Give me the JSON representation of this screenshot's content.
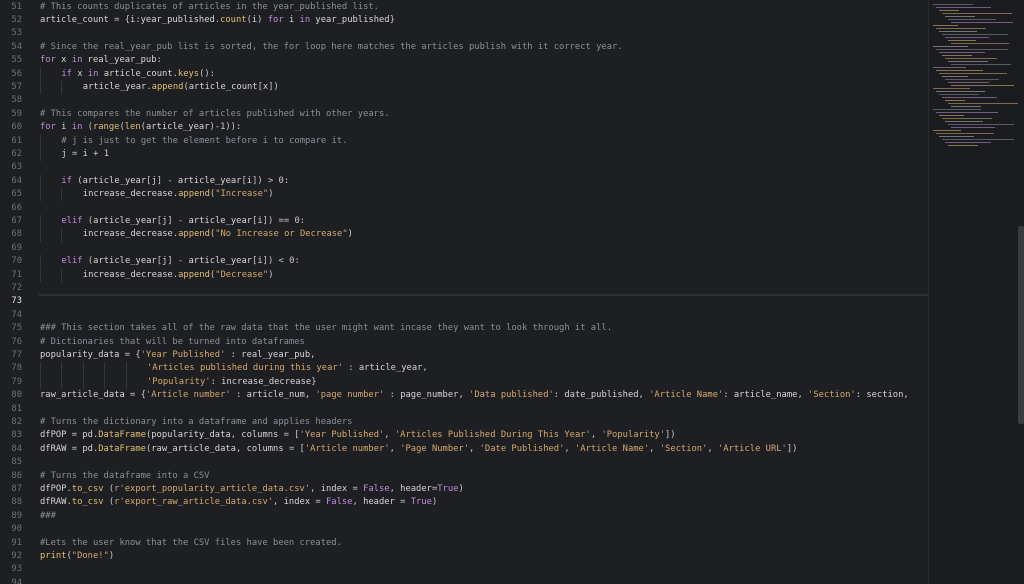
{
  "editor": {
    "current_line": 73,
    "lines": [
      {
        "n": 51,
        "indent": 0,
        "tokens": [
          [
            "cm",
            "# This counts duplicates of articles in the year_published list."
          ]
        ]
      },
      {
        "n": 52,
        "indent": 0,
        "tokens": [
          [
            "id",
            "article_count "
          ],
          [
            "op",
            "= {"
          ],
          [
            "id",
            "i"
          ],
          [
            "op",
            ":"
          ],
          [
            "id",
            "year_published"
          ],
          [
            "op",
            "."
          ],
          [
            "fn",
            "count"
          ],
          [
            "op",
            "("
          ],
          [
            "id",
            "i"
          ],
          [
            "op",
            ") "
          ],
          [
            "kw",
            "for"
          ],
          [
            "id",
            " i "
          ],
          [
            "kw",
            "in"
          ],
          [
            "id",
            " year_published"
          ],
          [
            "op",
            "}"
          ]
        ]
      },
      {
        "n": 53,
        "indent": 0,
        "tokens": []
      },
      {
        "n": 54,
        "indent": 0,
        "tokens": [
          [
            "cm",
            "# Since the real_year_pub list is sorted, the for loop here matches the articles publish with it correct year."
          ]
        ]
      },
      {
        "n": 55,
        "indent": 0,
        "tokens": [
          [
            "kw",
            "for"
          ],
          [
            "id",
            " x "
          ],
          [
            "kw",
            "in"
          ],
          [
            "id",
            " real_year_pub"
          ],
          [
            "op",
            ":"
          ]
        ]
      },
      {
        "n": 56,
        "indent": 1,
        "tokens": [
          [
            "kw",
            "if"
          ],
          [
            "id",
            " x "
          ],
          [
            "kw",
            "in"
          ],
          [
            "id",
            " article_count"
          ],
          [
            "op",
            "."
          ],
          [
            "fn",
            "keys"
          ],
          [
            "op",
            "():"
          ]
        ]
      },
      {
        "n": 57,
        "indent": 2,
        "tokens": [
          [
            "id",
            "article_year"
          ],
          [
            "op",
            "."
          ],
          [
            "fn",
            "append"
          ],
          [
            "op",
            "("
          ],
          [
            "id",
            "article_count"
          ],
          [
            "op",
            "["
          ],
          [
            "id",
            "x"
          ],
          [
            "op",
            "])"
          ]
        ]
      },
      {
        "n": 58,
        "indent": 0,
        "tokens": []
      },
      {
        "n": 59,
        "indent": 0,
        "tokens": [
          [
            "cm",
            "# This compares the number of articles published with other years."
          ]
        ]
      },
      {
        "n": 60,
        "indent": 0,
        "tokens": [
          [
            "kw",
            "for"
          ],
          [
            "id",
            " i "
          ],
          [
            "kw",
            "in"
          ],
          [
            "op",
            " ("
          ],
          [
            "fn",
            "range"
          ],
          [
            "op",
            "("
          ],
          [
            "fn",
            "len"
          ],
          [
            "op",
            "("
          ],
          [
            "id",
            "article_year"
          ],
          [
            "op",
            ")-1)):"
          ]
        ]
      },
      {
        "n": 61,
        "indent": 1,
        "tokens": [
          [
            "cm",
            "# j is just to get the element before i to compare it."
          ]
        ]
      },
      {
        "n": 62,
        "indent": 1,
        "tokens": [
          [
            "id",
            "j "
          ],
          [
            "op",
            "= "
          ],
          [
            "id",
            "i "
          ],
          [
            "op",
            "+ 1"
          ]
        ]
      },
      {
        "n": 63,
        "indent": 0,
        "tokens": []
      },
      {
        "n": 64,
        "indent": 1,
        "tokens": [
          [
            "kw",
            "if"
          ],
          [
            "op",
            " ("
          ],
          [
            "id",
            "article_year"
          ],
          [
            "op",
            "["
          ],
          [
            "id",
            "j"
          ],
          [
            "op",
            "] - "
          ],
          [
            "id",
            "article_year"
          ],
          [
            "op",
            "["
          ],
          [
            "id",
            "i"
          ],
          [
            "op",
            "]) > 0:"
          ]
        ]
      },
      {
        "n": 65,
        "indent": 2,
        "tokens": [
          [
            "id",
            "increase_decrease"
          ],
          [
            "op",
            "."
          ],
          [
            "fn",
            "append"
          ],
          [
            "op",
            "("
          ],
          [
            "str",
            "\"Increase\""
          ],
          [
            "op",
            ")"
          ]
        ]
      },
      {
        "n": 66,
        "indent": 0,
        "tokens": []
      },
      {
        "n": 67,
        "indent": 1,
        "tokens": [
          [
            "kw",
            "elif"
          ],
          [
            "op",
            " ("
          ],
          [
            "id",
            "article_year"
          ],
          [
            "op",
            "["
          ],
          [
            "id",
            "j"
          ],
          [
            "op",
            "] - "
          ],
          [
            "id",
            "article_year"
          ],
          [
            "op",
            "["
          ],
          [
            "id",
            "i"
          ],
          [
            "op",
            "]) == 0:"
          ]
        ]
      },
      {
        "n": 68,
        "indent": 2,
        "tokens": [
          [
            "id",
            "increase_decrease"
          ],
          [
            "op",
            "."
          ],
          [
            "fn",
            "append"
          ],
          [
            "op",
            "("
          ],
          [
            "str",
            "\"No Increase or Decrease\""
          ],
          [
            "op",
            ")"
          ]
        ]
      },
      {
        "n": 69,
        "indent": 0,
        "tokens": []
      },
      {
        "n": 70,
        "indent": 1,
        "tokens": [
          [
            "kw",
            "elif"
          ],
          [
            "op",
            " ("
          ],
          [
            "id",
            "article_year"
          ],
          [
            "op",
            "["
          ],
          [
            "id",
            "j"
          ],
          [
            "op",
            "] - "
          ],
          [
            "id",
            "article_year"
          ],
          [
            "op",
            "["
          ],
          [
            "id",
            "i"
          ],
          [
            "op",
            "]) < 0:"
          ]
        ]
      },
      {
        "n": 71,
        "indent": 2,
        "tokens": [
          [
            "id",
            "increase_decrease"
          ],
          [
            "op",
            "."
          ],
          [
            "fn",
            "append"
          ],
          [
            "op",
            "("
          ],
          [
            "str",
            "\"Decrease\""
          ],
          [
            "op",
            ")"
          ]
        ]
      },
      {
        "n": 72,
        "indent": 0,
        "tokens": []
      },
      {
        "n": 73,
        "indent": 0,
        "tokens": []
      },
      {
        "n": 74,
        "indent": 0,
        "tokens": []
      },
      {
        "n": 75,
        "indent": 0,
        "tokens": [
          [
            "cm",
            "### This section takes all of the raw data that the user might want incase they want to look through it all."
          ]
        ]
      },
      {
        "n": 76,
        "indent": 0,
        "tokens": [
          [
            "cm",
            "# Dictionaries that will be turned into dataframes"
          ]
        ]
      },
      {
        "n": 77,
        "indent": 0,
        "tokens": [
          [
            "id",
            "popularity_data "
          ],
          [
            "op",
            "= {"
          ],
          [
            "str",
            "'Year Published'"
          ],
          [
            "op",
            " : "
          ],
          [
            "id",
            "real_year_pub"
          ],
          [
            "op",
            ","
          ]
        ]
      },
      {
        "n": 78,
        "indent": 5,
        "tokens": [
          [
            "str",
            "'Articles published during this year'"
          ],
          [
            "op",
            " : "
          ],
          [
            "id",
            "article_year"
          ],
          [
            "op",
            ","
          ]
        ]
      },
      {
        "n": 79,
        "indent": 5,
        "tokens": [
          [
            "str",
            "'Popularity'"
          ],
          [
            "op",
            ": "
          ],
          [
            "id",
            "increase_decrease"
          ],
          [
            "op",
            "}"
          ]
        ]
      },
      {
        "n": 80,
        "indent": 0,
        "tokens": [
          [
            "id",
            "raw_article_data "
          ],
          [
            "op",
            "= {"
          ],
          [
            "str",
            "'Article number'"
          ],
          [
            "op",
            " : "
          ],
          [
            "id",
            "article_num"
          ],
          [
            "op",
            ", "
          ],
          [
            "str",
            "'page number'"
          ],
          [
            "op",
            " : "
          ],
          [
            "id",
            "page_number"
          ],
          [
            "op",
            ", "
          ],
          [
            "str",
            "'Data published'"
          ],
          [
            "op",
            ": "
          ],
          [
            "id",
            "date_published"
          ],
          [
            "op",
            ", "
          ],
          [
            "str",
            "'Article Name'"
          ],
          [
            "op",
            ": "
          ],
          [
            "id",
            "article_name"
          ],
          [
            "op",
            ", "
          ],
          [
            "str",
            "'Section'"
          ],
          [
            "op",
            ": "
          ],
          [
            "id",
            "section"
          ],
          [
            "op",
            ","
          ]
        ]
      },
      {
        "n": 81,
        "indent": 0,
        "tokens": []
      },
      {
        "n": 82,
        "indent": 0,
        "tokens": [
          [
            "cm",
            "# Turns the dictionary into a dataframe and applies headers"
          ]
        ]
      },
      {
        "n": 83,
        "indent": 0,
        "tokens": [
          [
            "id",
            "dfPOP "
          ],
          [
            "op",
            "= "
          ],
          [
            "id",
            "pd"
          ],
          [
            "op",
            "."
          ],
          [
            "fn",
            "DataFrame"
          ],
          [
            "op",
            "("
          ],
          [
            "id",
            "popularity_data"
          ],
          [
            "op",
            ", "
          ],
          [
            "id",
            "columns "
          ],
          [
            "op",
            "= ["
          ],
          [
            "str",
            "'Year Published'"
          ],
          [
            "op",
            ", "
          ],
          [
            "str",
            "'Articles Published During This Year'"
          ],
          [
            "op",
            ", "
          ],
          [
            "str",
            "'Popularity'"
          ],
          [
            "op",
            "])"
          ]
        ]
      },
      {
        "n": 84,
        "indent": 0,
        "tokens": [
          [
            "id",
            "dfRAW "
          ],
          [
            "op",
            "= "
          ],
          [
            "id",
            "pd"
          ],
          [
            "op",
            "."
          ],
          [
            "fn",
            "DataFrame"
          ],
          [
            "op",
            "("
          ],
          [
            "id",
            "raw_article_data"
          ],
          [
            "op",
            ", "
          ],
          [
            "id",
            "columns "
          ],
          [
            "op",
            "= ["
          ],
          [
            "str",
            "'Article number'"
          ],
          [
            "op",
            ", "
          ],
          [
            "str",
            "'Page Number'"
          ],
          [
            "op",
            ", "
          ],
          [
            "str",
            "'Date Published'"
          ],
          [
            "op",
            ", "
          ],
          [
            "str",
            "'Article Name'"
          ],
          [
            "op",
            ", "
          ],
          [
            "str",
            "'Section'"
          ],
          [
            "op",
            ", "
          ],
          [
            "str",
            "'Article URL'"
          ],
          [
            "op",
            "])"
          ]
        ]
      },
      {
        "n": 85,
        "indent": 0,
        "tokens": []
      },
      {
        "n": 86,
        "indent": 0,
        "tokens": [
          [
            "cm",
            "# Turns the dataframe into a CSV"
          ]
        ]
      },
      {
        "n": 87,
        "indent": 0,
        "tokens": [
          [
            "id",
            "dfPOP"
          ],
          [
            "op",
            "."
          ],
          [
            "fn",
            "to_csv"
          ],
          [
            "op",
            " ("
          ],
          [
            "str",
            "r'export_popularity_article_data.csv'"
          ],
          [
            "op",
            ", "
          ],
          [
            "id",
            "index "
          ],
          [
            "op",
            "= "
          ],
          [
            "kw",
            "False"
          ],
          [
            "op",
            ", "
          ],
          [
            "id",
            "header"
          ],
          [
            "op",
            "="
          ],
          [
            "kw",
            "True"
          ],
          [
            "op",
            ")"
          ]
        ]
      },
      {
        "n": 88,
        "indent": 0,
        "tokens": [
          [
            "id",
            "dfRAW"
          ],
          [
            "op",
            "."
          ],
          [
            "fn",
            "to_csv"
          ],
          [
            "op",
            " ("
          ],
          [
            "str",
            "r'export_raw_article_data.csv'"
          ],
          [
            "op",
            ", "
          ],
          [
            "id",
            "index "
          ],
          [
            "op",
            "= "
          ],
          [
            "kw",
            "False"
          ],
          [
            "op",
            ", "
          ],
          [
            "id",
            "header "
          ],
          [
            "op",
            "= "
          ],
          [
            "kw",
            "True"
          ],
          [
            "op",
            ")"
          ]
        ]
      },
      {
        "n": 89,
        "indent": 0,
        "tokens": [
          [
            "cm",
            "###"
          ]
        ]
      },
      {
        "n": 90,
        "indent": 0,
        "tokens": []
      },
      {
        "n": 91,
        "indent": 0,
        "tokens": [
          [
            "cm",
            "#Lets the user know that the CSV files have been created."
          ]
        ]
      },
      {
        "n": 92,
        "indent": 0,
        "tokens": [
          [
            "fn",
            "print"
          ],
          [
            "op",
            "("
          ],
          [
            "str",
            "\"Done!\""
          ],
          [
            "op",
            ")"
          ]
        ]
      },
      {
        "n": 93,
        "indent": 0,
        "tokens": []
      },
      {
        "n": 94,
        "indent": 0,
        "tokens": []
      }
    ]
  },
  "colors": {
    "background": "#1e1f22",
    "comment": "#8b8f99",
    "keyword": "#c08ddb",
    "function": "#e0c070",
    "string": "#d6a86e",
    "line_number": "#6e7079"
  }
}
